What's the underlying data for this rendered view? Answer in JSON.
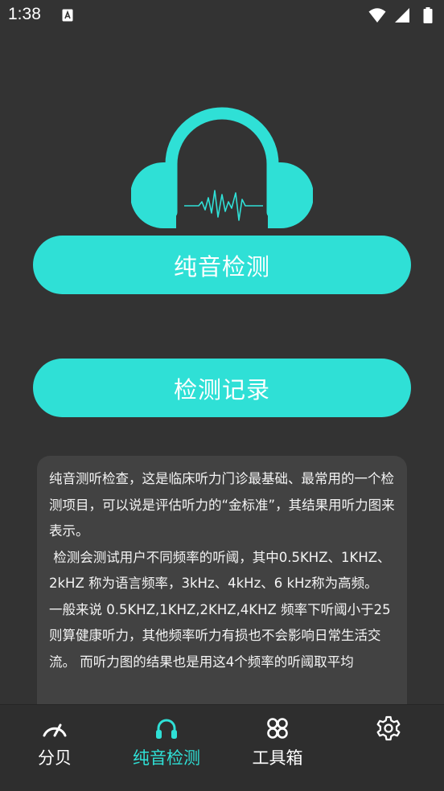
{
  "status_bar": {
    "time": "1:38",
    "notification_icon": "a-notification-icon",
    "icons": [
      "wifi-icon",
      "signal-icon",
      "battery-icon"
    ]
  },
  "logo": {
    "icon": "headphones-waveform-icon"
  },
  "buttons": {
    "pure_tone": "纯音检测",
    "records": "检测记录"
  },
  "description": {
    "text": "纯音测听检查，这是临床听力门诊最基础、最常用的一个检测项目，可以说是评估听力的“金标准”，其结果用听力图来表示。\n 检测会测试用户不同频率的听阈，其中0.5KHZ、1KHZ、2kHZ 称为语言频率，3kHz、4kHz、6 kHz称为高频。\n一般来说 0.5KHZ,1KHZ,2KHZ,4KHZ 频率下听阈小于25则算健康听力，其他频率听力有损也不会影响日常生活交流。 而听力图的结果也是用这4个频率的听阈取平均"
  },
  "bottom_nav": {
    "items": [
      {
        "label": "分贝",
        "icon": "gauge-icon"
      },
      {
        "label": "纯音检测",
        "icon": "headphones-icon",
        "active": true
      },
      {
        "label": "工具箱",
        "icon": "grid-icon"
      },
      {
        "label": "",
        "icon": "gear-icon"
      }
    ]
  },
  "colors": {
    "accent": "#2fe0d6",
    "background": "#333333",
    "card": "#424242",
    "nav": "#2e2e2e"
  }
}
